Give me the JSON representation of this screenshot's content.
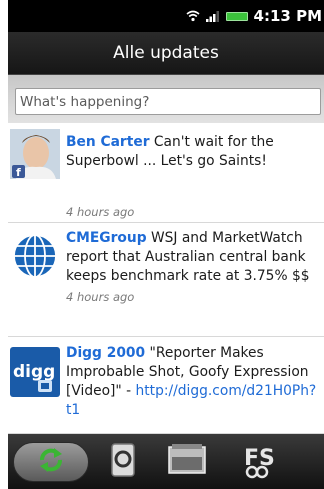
{
  "status": {
    "time": "4:13 PM",
    "battery_color": "#3cc23c"
  },
  "title": "Alle updates",
  "search": {
    "placeholder": "What's happening?"
  },
  "feed": [
    {
      "author": "Ben Carter",
      "text": "Can't wait for the Superbowl ... Let's go Saints!",
      "time": "4 hours ago",
      "avatar": "person-with-facebook-badge"
    },
    {
      "author": "CMEGroup",
      "text": "WSJ and MarketWatch report that Australian central bank keeps benchmark rate at 3.75% $$",
      "time": "4 hours ago",
      "avatar": "globe-logo"
    },
    {
      "author": "Digg 2000",
      "text": "\"Reporter Makes Improbable Shot, Goofy Expression [Video]\" - ",
      "link": "http://digg.com/d21H0Ph?t1",
      "avatar": "digg-logo"
    }
  ],
  "tabs": [
    {
      "name": "refresh",
      "icon": "refresh-icon",
      "active": true
    },
    {
      "name": "phone",
      "icon": "phone-icon"
    },
    {
      "name": "photos",
      "icon": "photos-icon"
    },
    {
      "name": "friendstream",
      "icon": "friendstream-icon"
    }
  ],
  "colors": {
    "accent": "#1f6bd6",
    "link": "#1f6bd6",
    "active_tab": "#3bb534"
  }
}
